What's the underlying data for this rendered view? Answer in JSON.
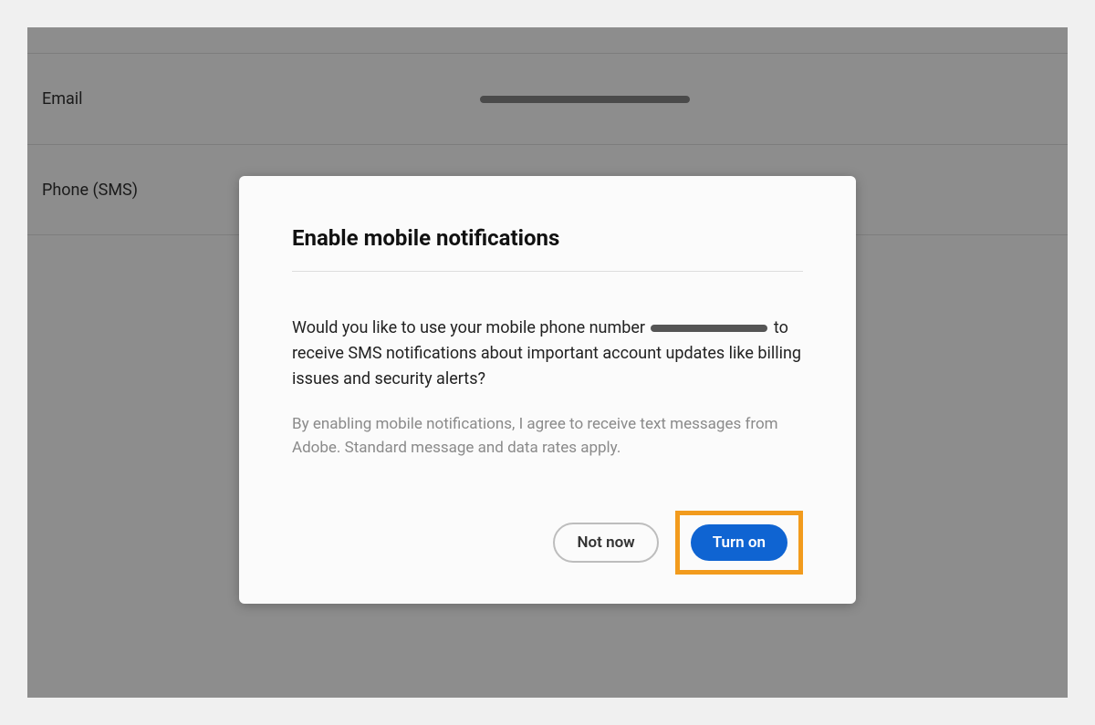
{
  "settings": {
    "rows": [
      {
        "label": "Email"
      },
      {
        "label": "Phone (SMS)"
      }
    ]
  },
  "modal": {
    "title": "Enable mobile notifications",
    "body_prefix": "Would you like to use your mobile phone number ",
    "body_suffix": " to receive SMS notifications about important account updates like billing issues and security alerts?",
    "disclaimer": "By enabling mobile notifications, I agree to receive text messages from Adobe. Standard message and data rates apply.",
    "not_now_label": "Not now",
    "turn_on_label": "Turn on"
  }
}
